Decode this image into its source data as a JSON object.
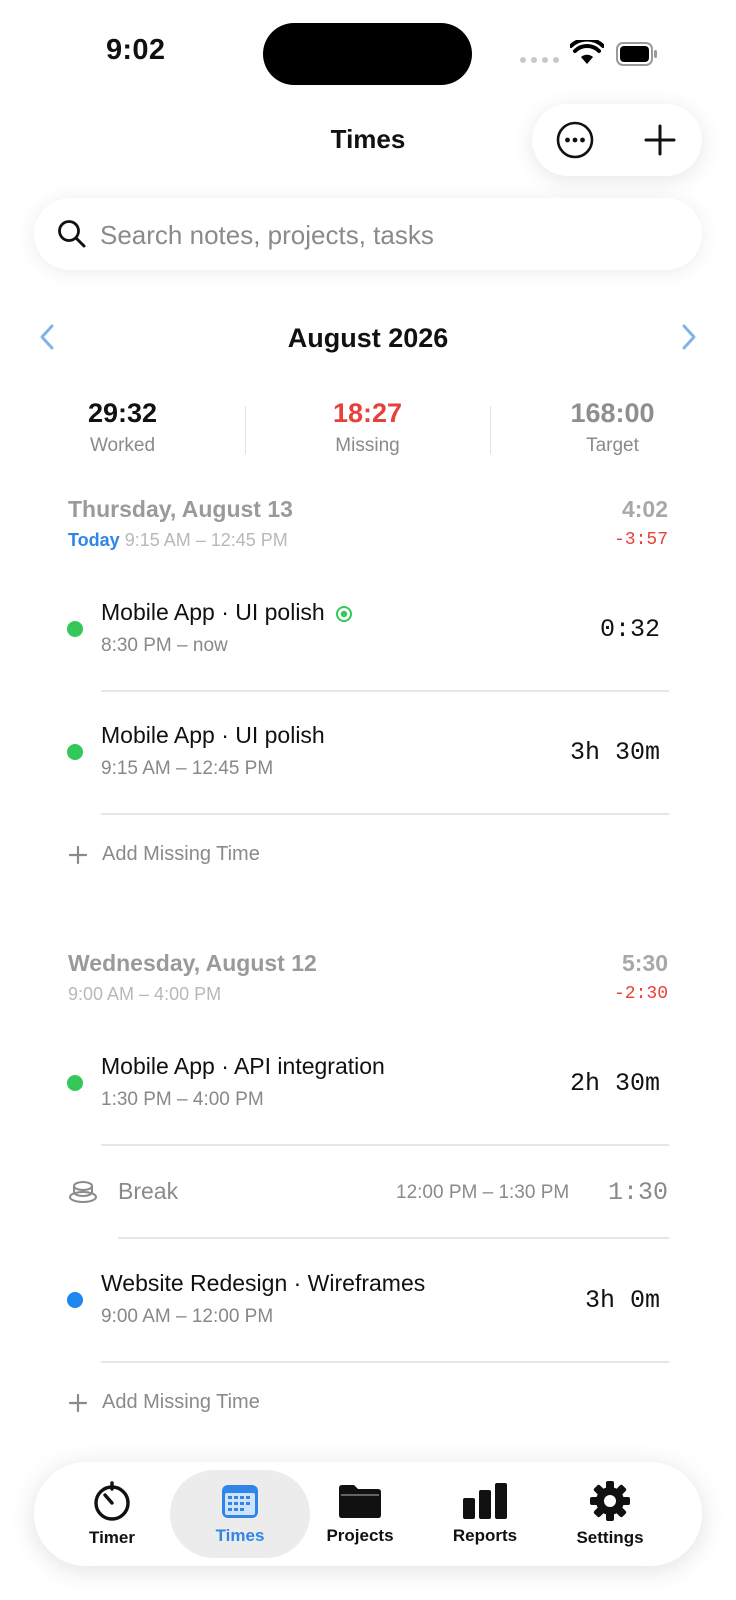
{
  "status": {
    "time": "9:02"
  },
  "nav": {
    "title": "Times"
  },
  "search": {
    "placeholder": "Search notes, projects, tasks"
  },
  "month": {
    "title": "August 2026"
  },
  "summary": {
    "worked": {
      "value": "29:32",
      "label": "Worked"
    },
    "missing": {
      "value": "18:27",
      "label": "Missing"
    },
    "target": {
      "value": "168:00",
      "label": "Target"
    }
  },
  "days": [
    {
      "title": "Thursday, August 13",
      "today_label": "Today",
      "range": "9:15 AM – 12:45 PM",
      "total": "4:02",
      "diff": "-3:57",
      "entries": [
        {
          "title": "Mobile App · UI polish",
          "time": "8:30 PM – now",
          "duration": "0:32",
          "color": "#34c759",
          "running": true
        },
        {
          "title": "Mobile App · UI polish",
          "time": "9:15 AM – 12:45 PM",
          "duration": "3h 30m",
          "color": "#34c759"
        }
      ],
      "add_label": "Add Missing Time"
    },
    {
      "title": "Wednesday, August 12",
      "range": "9:00 AM – 4:00 PM",
      "total": "5:30",
      "diff": "-2:30",
      "entries": [
        {
          "title": "Mobile App · API integration",
          "time": "1:30 PM – 4:00 PM",
          "duration": "2h 30m",
          "color": "#34c759"
        },
        {
          "title": "Website Redesign · Wireframes",
          "time": "9:00 AM – 12:00 PM",
          "duration": "3h 0m",
          "color": "#1e86f0"
        }
      ],
      "break": {
        "label": "Break",
        "range": "12:00 PM – 1:30 PM",
        "duration": "1:30"
      },
      "add_label": "Add Missing Time"
    }
  ],
  "tabs": [
    {
      "label": "Timer",
      "icon": "timer-icon"
    },
    {
      "label": "Times",
      "icon": "calendar-icon",
      "active": true
    },
    {
      "label": "Projects",
      "icon": "folder-icon"
    },
    {
      "label": "Reports",
      "icon": "bar-chart-icon"
    },
    {
      "label": "Settings",
      "icon": "gear-icon"
    }
  ],
  "colors": {
    "accent": "#2f86e8",
    "negative": "#e8403a",
    "green": "#34c759",
    "blue": "#1e86f0"
  }
}
